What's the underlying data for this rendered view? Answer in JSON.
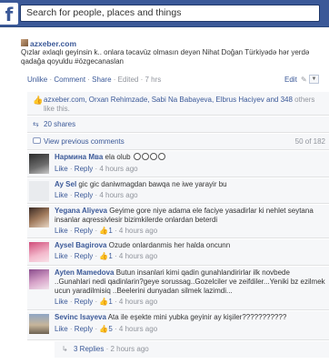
{
  "header": {
    "logo": "f",
    "search_placeholder": "Search for people, places and things"
  },
  "post": {
    "source": "azxeber.com",
    "text": "Qızlar əxlaqlı geyinsin k.. onlara təcavüz olmasın deyən Nihat Doğan Türkiyədə hər yerdə qadağa qoyuldu #özgecanaslan",
    "actions": {
      "unlike": "Unlike",
      "comment": "Comment",
      "share": "Share",
      "edited": "Edited",
      "time": "7 hrs",
      "edit": "Edit",
      "pencil": "✎",
      "chevron": "▼"
    }
  },
  "likes": {
    "icon": "thumbs-up",
    "names": "azxeber.com, Orxan Rehimzade, Sabi Na Babayeva, Elbrus Haciyev and 348",
    "suffix": "others like this."
  },
  "shares": {
    "icon": "share",
    "label": "20 shares"
  },
  "previous": {
    "label": "View previous comments",
    "count": "50 of 182"
  },
  "comments": [
    {
      "author": "Нармина Мва",
      "text": "ela olub",
      "like": "Like",
      "reply": "Reply",
      "likes": "",
      "time": "4 hours ago"
    },
    {
      "author": "Ay Sel",
      "text": "gic gic daniwmagdan bawqa ne iwe yarayir bu",
      "like": "Like",
      "reply": "Reply",
      "likes": "",
      "time": "4 hours ago"
    },
    {
      "author": "Yegana Aliyeva",
      "text": "Geyime gore niye adama ele faciye yasadirlar ki nehlet seytana insanlar aqressivlesir bizimkilerde onlardan beterdi",
      "like": "Like",
      "reply": "Reply",
      "likes": "1",
      "time": "4 hours ago"
    },
    {
      "author": "Aysel Bagirova",
      "text": "Ozude onlardanmis her halda oncunn",
      "like": "Like",
      "reply": "Reply",
      "likes": "1",
      "time": "4 hours ago"
    },
    {
      "author": "Ayten Mamedova",
      "text": "Butun insanlari kimi qadin gunahlandirirlar ilk novbede ..Gunahlari nedi qadinlarin?geye sorussag..Gozelciler ve zeifdiler...Yeniki bz ezilmek ucun yaradilmisiq ..Beelerini dunyadan silmek lazimdi...",
      "like": "Like",
      "reply": "Reply",
      "likes": "1",
      "time": "4 hours ago"
    },
    {
      "author": "Sevinc Isayeva",
      "text": "Ata ile eşekte mini yubka geyinir ay kişiler???????????",
      "like": "Like",
      "reply": "Reply",
      "likes": "5",
      "time": "4 hours ago"
    }
  ],
  "replies": {
    "label": "3 Replies",
    "time": "2 hours ago"
  },
  "colors": {
    "brand": "#3b5998",
    "background": "#f6f7f9"
  }
}
